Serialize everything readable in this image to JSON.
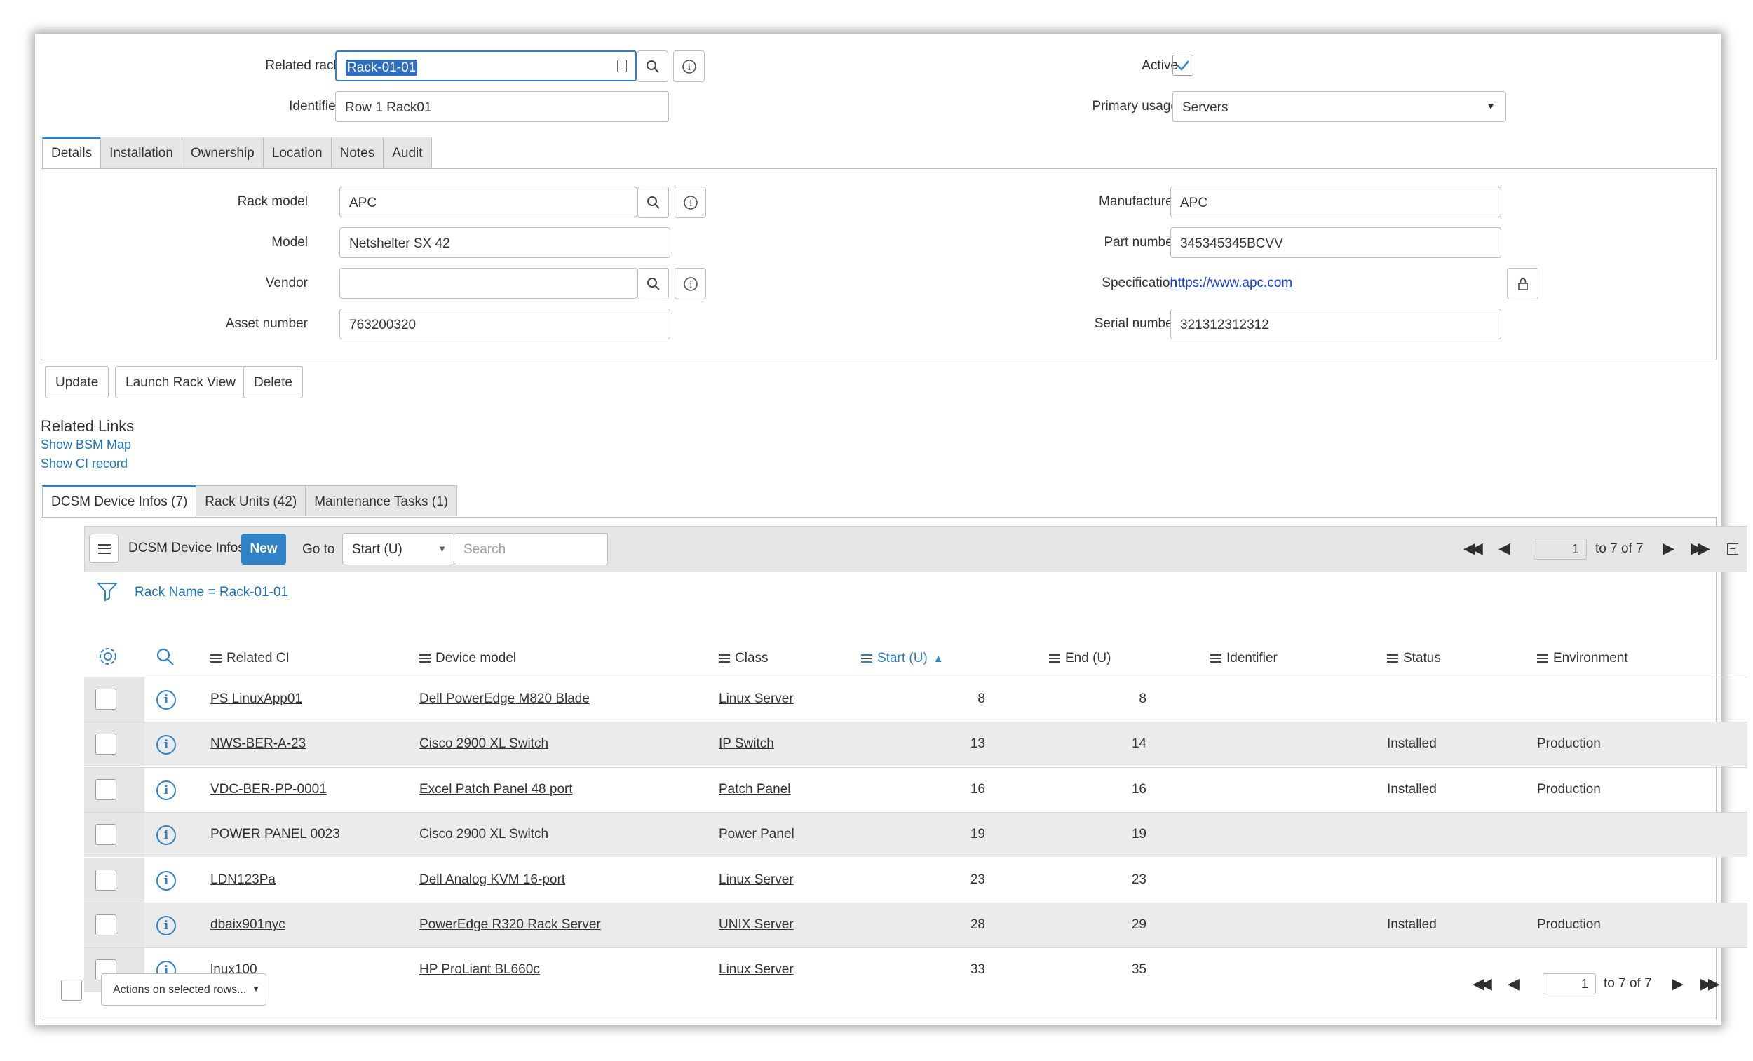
{
  "form": {
    "related_rack_label": "Related rack",
    "related_rack_value": "Rack-01-01",
    "identifier_label": "Identifier",
    "identifier_value": "Row 1 Rack01",
    "active_label": "Active",
    "active_checked": true,
    "primary_usage_label": "Primary usage",
    "primary_usage_value": "Servers"
  },
  "tabs": [
    "Details",
    "Installation",
    "Ownership",
    "Location",
    "Notes",
    "Audit"
  ],
  "details": {
    "rack_model_label": "Rack model",
    "rack_model_value": "APC",
    "model_label": "Model",
    "model_value": "Netshelter SX 42",
    "vendor_label": "Vendor",
    "vendor_value": "",
    "asset_number_label": "Asset number",
    "asset_number_value": "763200320",
    "manufacturer_label": "Manufacturer",
    "manufacturer_value": "APC",
    "part_number_label": "Part number",
    "part_number_value": "345345345BCVV",
    "specification_label": "Specification",
    "specification_value": "https://www.apc.com",
    "serial_number_label": "Serial number",
    "serial_number_value": "321312312312"
  },
  "actions": {
    "update": "Update",
    "launch": "Launch Rack View",
    "delete": "Delete"
  },
  "related_links": {
    "title": "Related Links",
    "bsm": "Show BSM Map",
    "ci": "Show CI record"
  },
  "related_tabs": [
    "DCSM Device Infos (7)",
    "Rack Units (42)",
    "Maintenance Tasks (1)"
  ],
  "list": {
    "title": "DCSM Device Infos",
    "new_label": "New",
    "goto_label": "Go to",
    "goto_field": "Start (U)",
    "search_placeholder": "Search",
    "page_value": "1",
    "page_info": "to 7 of 7",
    "filter": "Rack Name = Rack-01-01",
    "columns": [
      "Related CI",
      "Device model",
      "Class",
      "Start (U)",
      "End (U)",
      "Identifier",
      "Status",
      "Environment"
    ],
    "rows": [
      {
        "ci": "PS LinuxApp01",
        "model": "Dell PowerEdge M820 Blade",
        "class": "Linux Server",
        "start": "8",
        "end": "8",
        "identifier": "",
        "status": "",
        "env": ""
      },
      {
        "ci": "NWS-BER-A-23",
        "model": "Cisco 2900 XL Switch",
        "class": "IP Switch",
        "start": "13",
        "end": "14",
        "identifier": "",
        "status": "Installed",
        "env": "Production"
      },
      {
        "ci": "VDC-BER-PP-0001",
        "model": "Excel Patch Panel 48 port",
        "class": "Patch Panel",
        "start": "16",
        "end": "16",
        "identifier": "",
        "status": "Installed",
        "env": "Production"
      },
      {
        "ci": "POWER PANEL 0023",
        "model": "Cisco 2900 XL Switch",
        "class": "Power Panel",
        "start": "19",
        "end": "19",
        "identifier": "",
        "status": "",
        "env": ""
      },
      {
        "ci": "LDN123Pa",
        "model": "Dell Analog KVM 16-port",
        "class": "Linux Server",
        "start": "23",
        "end": "23",
        "identifier": "",
        "status": "",
        "env": ""
      },
      {
        "ci": "dbaix901nyc",
        "model": "PowerEdge R320 Rack Server",
        "class": "UNIX Server",
        "start": "28",
        "end": "29",
        "identifier": "",
        "status": "Installed",
        "env": "Production"
      },
      {
        "ci": "lnux100",
        "model": "HP ProLiant BL660c",
        "class": "Linux Server",
        "start": "33",
        "end": "35",
        "identifier": "",
        "status": "",
        "env": ""
      }
    ],
    "actions_select": "Actions on selected rows..."
  },
  "colors": {
    "accent": "#2f82c6",
    "new_button": "#2f82c6"
  }
}
